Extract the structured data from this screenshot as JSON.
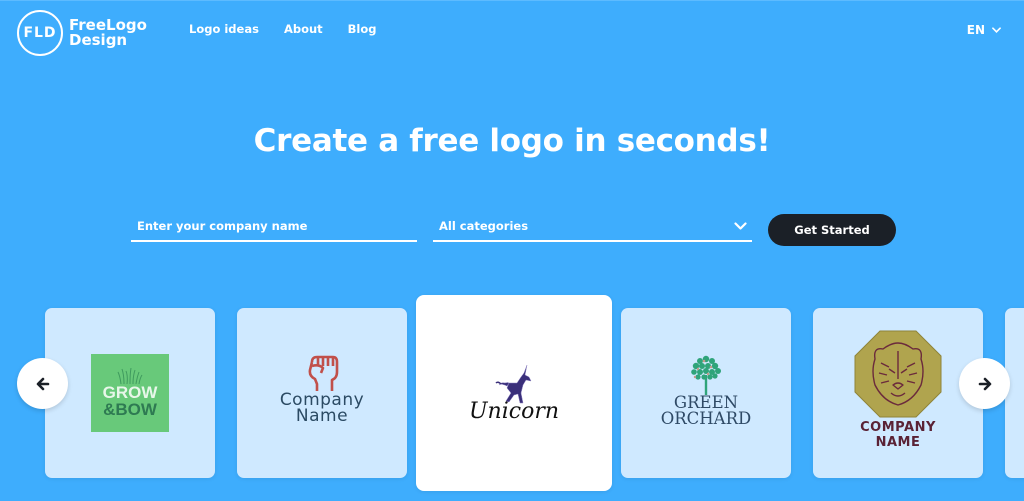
{
  "header": {
    "logo_mark": "FLD",
    "logo_line1": "FreeLogo",
    "logo_line2": "Design",
    "nav": [
      {
        "label": "Logo ideas"
      },
      {
        "label": "About"
      },
      {
        "label": "Blog"
      }
    ],
    "language": "EN"
  },
  "hero": {
    "title": "Create a free logo in seconds!",
    "company_input": {
      "placeholder": "Enter your company name",
      "value": ""
    },
    "category_select": {
      "selected": "All categories"
    },
    "cta_label": "Get Started"
  },
  "carousel": {
    "prev_icon": "arrow-left-icon",
    "next_icon": "arrow-right-icon",
    "cards": [
      {
        "name": "grow-and-bow",
        "line1": "GROW",
        "line2": "&BOW",
        "icon": "grass-icon",
        "colors": {
          "bg": "#68c97a",
          "text1": "#e8f7ea",
          "text2": "#2e7a52"
        }
      },
      {
        "name": "fist-company",
        "line1": "Company",
        "line2": "Name",
        "icon": "fist-icon",
        "colors": {
          "icon": "#c1504a",
          "text": "#2b4a63"
        }
      },
      {
        "name": "unicorn",
        "line1": "Unicorn",
        "icon": "unicorn-icon",
        "active": true,
        "colors": {
          "icon": "#3a2f7a",
          "text": "#111111"
        }
      },
      {
        "name": "green-orchard",
        "line1": "GREEN",
        "line2": "ORCHARD",
        "icon": "tree-icon",
        "colors": {
          "icon": "#2fa47a",
          "text": "#2f4a66"
        }
      },
      {
        "name": "tiger-company",
        "line1": "COMPANY",
        "line2": "NAME",
        "icon": "tiger-icon",
        "colors": {
          "badge": "#b0a44e",
          "line": "#6b2a3c",
          "text": "#5a2235"
        }
      }
    ]
  },
  "colors": {
    "background": "#3eadfd",
    "card_bg": "#cfe9ff",
    "cta_bg": "#1b2027"
  }
}
